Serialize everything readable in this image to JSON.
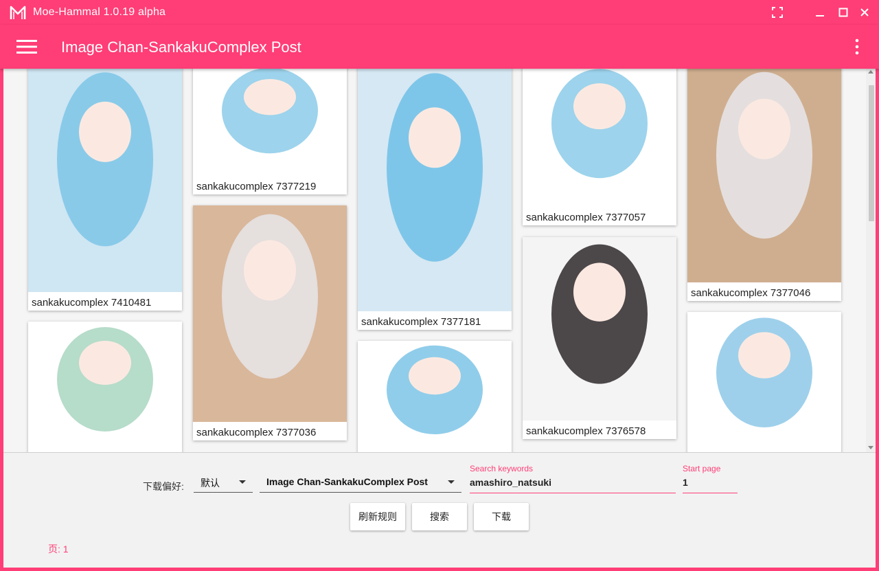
{
  "window": {
    "title": "Moe-Hammal 1.0.19 alpha",
    "accent_color": "#ff3d76"
  },
  "appbar": {
    "title": "Image Chan-SankakuComplex Post"
  },
  "gallery": {
    "cards": [
      {
        "label": "sankakucomplex 7410481",
        "bg": "#cfe6f3",
        "hair": "#7cc4e6"
      },
      {
        "label": "sankakucomplex 7377219",
        "bg": "#ffffff",
        "hair": "#8ccbe9"
      },
      {
        "label": "sankakucomplex 7377036",
        "bg": "#d9b79a",
        "hair": "#e6e6ea"
      },
      {
        "label": "sankakucomplex 7377181",
        "bg": "#d6e8f3",
        "hair": "#6fbfe6"
      },
      {
        "label": "",
        "bg": "#ffffff",
        "hair": "#7cc4e6"
      },
      {
        "label": "sankakucomplex 7377057",
        "bg": "#ffffff",
        "hair": "#8ccbe9"
      },
      {
        "label": "sankakucomplex 7376578",
        "bg": "#f4f4f4",
        "hair": "#2e2829"
      },
      {
        "label": "sankakucomplex 7377046",
        "bg": "#cfae8f",
        "hair": "#e8e8ec"
      },
      {
        "label": "",
        "bg": "#ffffff",
        "hair": "#8dc8e8"
      },
      {
        "label": "",
        "bg": "#ffffff",
        "hair": "#a9d6c1"
      }
    ]
  },
  "controls": {
    "download_pref_label": "下载偏好:",
    "download_pref_value": "默认",
    "site_value": "Image Chan-SankakuComplex Post",
    "search_label": "Search keywords",
    "search_value": "amashiro_natsuki",
    "start_page_label": "Start page",
    "start_page_value": "1",
    "refresh_button": "刷新规则",
    "search_button": "搜索",
    "download_button": "下载",
    "page_indicator": "页: 1"
  }
}
